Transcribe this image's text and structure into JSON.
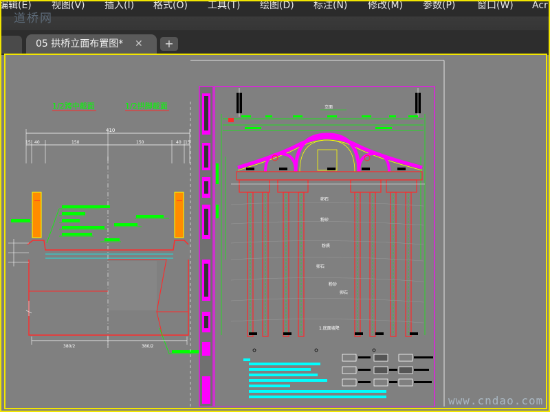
{
  "menu": {
    "items": [
      {
        "id": "edit",
        "label": "编辑(E)"
      },
      {
        "id": "view",
        "label": "视图(V)"
      },
      {
        "id": "insert",
        "label": "插入(I)"
      },
      {
        "id": "format",
        "label": "格式(O)"
      },
      {
        "id": "tools",
        "label": "工具(T)"
      },
      {
        "id": "draw",
        "label": "绘图(D)"
      },
      {
        "id": "dimension",
        "label": "标注(N)"
      },
      {
        "id": "modify",
        "label": "修改(M)"
      },
      {
        "id": "param",
        "label": "参数(P)"
      },
      {
        "id": "window",
        "label": "窗口(W)"
      },
      {
        "id": "more",
        "label": "Acr"
      }
    ]
  },
  "watermark_top": "道桥网",
  "watermark_bottom": "www.cndao.com",
  "tabs": {
    "active_label": "05 拱桥立面布置图*",
    "close_glyph": "✕",
    "add_glyph": "+"
  },
  "drawing": {
    "section_left_title": "1/2跨中截面",
    "section_right_title": "1/2拱脚截面",
    "dim_total": "410",
    "dim_parts": [
      "15",
      "40",
      "150",
      "150",
      "40",
      "15"
    ],
    "dim_bottom_left": "380/2",
    "dim_bottom_right": "380/2",
    "soil_labels": [
      "卵石",
      "粉砂",
      "粉质",
      "卵石",
      "粉砂",
      "卵石"
    ],
    "bottom_label": "1.底面坡降",
    "top_label": "立面",
    "colors": {
      "green": "#00ff00",
      "red": "#ff2a2a",
      "magenta": "#ff00ff",
      "cyan": "#00ffff",
      "yellow": "#ffff00",
      "orange": "#ff8c00",
      "white": "#ffffff",
      "black": "#000000"
    }
  }
}
